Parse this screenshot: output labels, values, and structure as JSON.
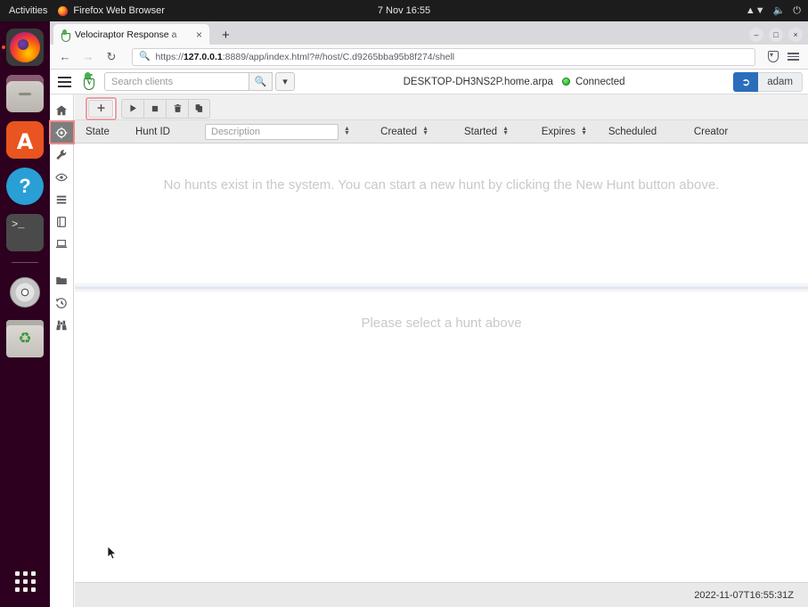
{
  "desktop": {
    "activities": "Activities",
    "active_app": "Firefox Web Browser",
    "clock": "7 Nov  16:55",
    "tray": {
      "network_icon": "network-icon",
      "volume_icon": "volume-icon",
      "power_icon": "power-icon"
    },
    "dock": [
      {
        "name": "firefox",
        "label": "Firefox Web Browser",
        "running": true
      },
      {
        "name": "files",
        "label": "Files",
        "running": false
      },
      {
        "name": "software",
        "label": "Ubuntu Software",
        "running": false
      },
      {
        "name": "help",
        "label": "Help",
        "running": false
      },
      {
        "name": "terminal",
        "label": "Terminal",
        "running": false
      },
      {
        "name": "disc",
        "label": "Disc Image",
        "running": false
      },
      {
        "name": "trash",
        "label": "Trash",
        "running": false
      }
    ],
    "show_apps": "Show Applications"
  },
  "browser": {
    "tab": {
      "title": "Velociraptor Response a",
      "close_label": "×"
    },
    "new_tab_label": "+",
    "window_controls": {
      "minimize": "–",
      "maximize": "□",
      "close": "×"
    },
    "nav": {
      "back": "←",
      "forward": "→",
      "reload": "↻"
    },
    "url": {
      "scheme": "https://",
      "host": "127.0.0.1",
      "rest": ":8889/app/index.html?#/host/C.d9265bba95b8f274/shell",
      "full": "https://127.0.0.1:8889/app/index.html?#/host/C.d9265bba95b8f274/shell"
    },
    "toolbar_right": {
      "save_to_pocket": "pocket-icon",
      "app_menu": "menu-icon"
    }
  },
  "app": {
    "header": {
      "menu_label": "menu-icon",
      "logo_label": "velociraptor-logo",
      "search": {
        "placeholder": "Search clients",
        "value": ""
      },
      "search_button": "search-icon",
      "search_dropdown": "▾",
      "hostname": "DESKTOP-DH3NS2P.home.arpa",
      "connection_status": "Connected",
      "logout_icon": "logout-icon",
      "username": "adam"
    },
    "nav_rail": [
      {
        "name": "home",
        "icon": "home-icon",
        "active": false
      },
      {
        "name": "hunts",
        "icon": "crosshair-icon",
        "active": true
      },
      {
        "name": "artifacts",
        "icon": "wrench-icon",
        "active": false
      },
      {
        "name": "monitoring",
        "icon": "eye-icon",
        "active": false
      },
      {
        "name": "server-events",
        "icon": "list-icon",
        "active": false
      },
      {
        "name": "notebooks",
        "icon": "book-icon",
        "active": false
      },
      {
        "name": "vfs",
        "icon": "laptop-icon",
        "active": false
      },
      {
        "name": "collected",
        "icon": "folder-icon",
        "active": false
      },
      {
        "name": "history",
        "icon": "history-icon",
        "active": false
      },
      {
        "name": "search",
        "icon": "binoculars-icon",
        "active": false
      }
    ],
    "toolbar": [
      {
        "name": "new-hunt",
        "icon": "plus-icon",
        "label": "+",
        "highlighted": true
      },
      {
        "name": "run-hunt",
        "icon": "play-icon",
        "label": "▶",
        "highlighted": false
      },
      {
        "name": "stop-hunt",
        "icon": "stop-icon",
        "label": "■",
        "highlighted": false
      },
      {
        "name": "delete-hunt",
        "icon": "trash-icon",
        "label": "Ὕ1",
        "highlighted": false
      },
      {
        "name": "copy-hunt",
        "icon": "copy-icon",
        "label": "❐",
        "highlighted": false
      }
    ],
    "table": {
      "columns": [
        {
          "key": "state",
          "label": "State",
          "sortable": false
        },
        {
          "key": "hunt_id",
          "label": "Hunt ID",
          "sortable": false
        },
        {
          "key": "description",
          "label": "Description",
          "sortable": true,
          "filter_placeholder": "Description",
          "filter_value": ""
        },
        {
          "key": "created",
          "label": "Created",
          "sortable": true
        },
        {
          "key": "started",
          "label": "Started",
          "sortable": true
        },
        {
          "key": "expires",
          "label": "Expires",
          "sortable": true
        },
        {
          "key": "scheduled",
          "label": "Scheduled",
          "sortable": false
        },
        {
          "key": "creator",
          "label": "Creator",
          "sortable": false
        }
      ],
      "rows": [],
      "empty_message": "No hunts exist in the system. You can start a new hunt by clicking the New Hunt button above."
    },
    "detail_placeholder": "Please select a hunt above",
    "status_timestamp": "2022-11-07T16:55:31Z"
  }
}
